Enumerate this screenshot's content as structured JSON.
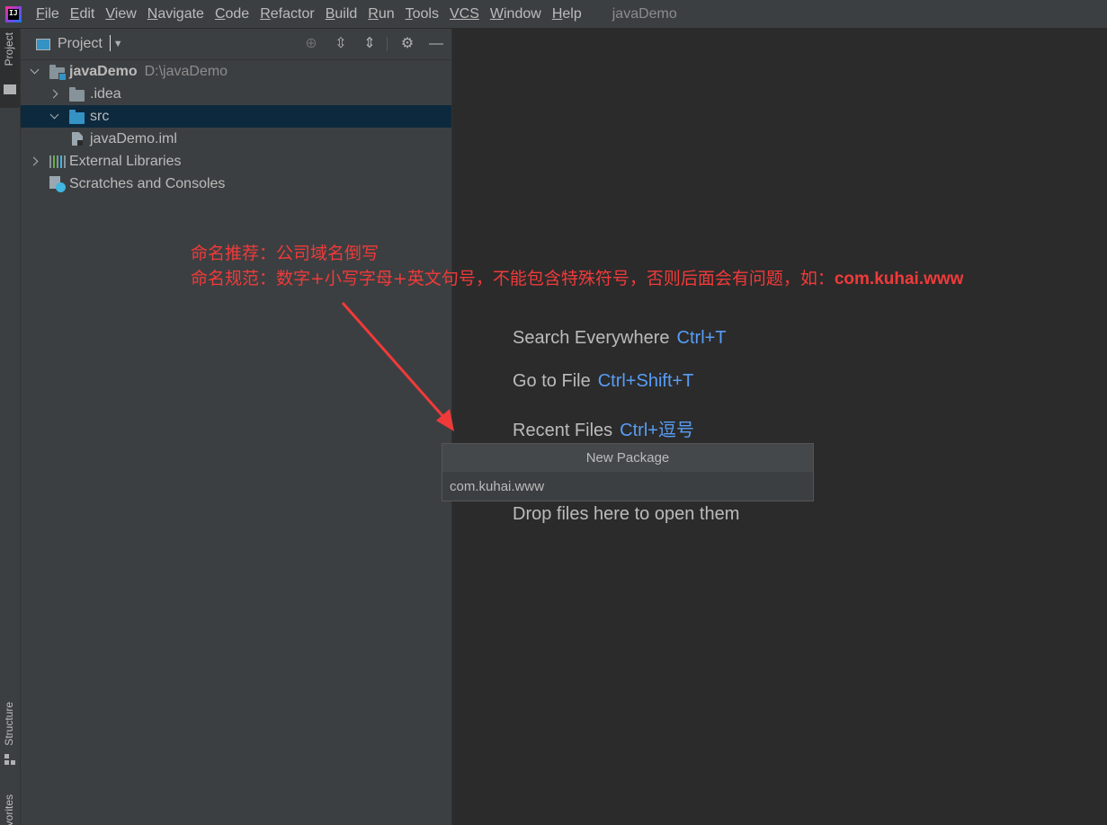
{
  "menubar": {
    "items": [
      {
        "mnemonic": "F",
        "rest": "ile"
      },
      {
        "mnemonic": "E",
        "rest": "dit"
      },
      {
        "mnemonic": "V",
        "rest": "iew"
      },
      {
        "mnemonic": "N",
        "rest": "avigate"
      },
      {
        "mnemonic": "C",
        "rest": "ode"
      },
      {
        "mnemonic": "R",
        "rest": "efactor"
      },
      {
        "mnemonic": "B",
        "rest": "uild"
      },
      {
        "mnemonic": "R",
        "rest": "un"
      },
      {
        "mnemonic": "T",
        "rest": "ools"
      },
      {
        "mnemonic": "",
        "rest": "VCS"
      },
      {
        "mnemonic": "W",
        "rest": "indow"
      },
      {
        "mnemonic": "H",
        "rest": "elp"
      }
    ],
    "window_title": "javaDemo"
  },
  "left_strip": {
    "project_tab": "Project",
    "structure_tab": "Structure",
    "favorites_tab": "Favorites"
  },
  "project_panel": {
    "title": "Project",
    "tree": {
      "root": {
        "label": "javaDemo",
        "path": "D:\\javaDemo"
      },
      "idea": ".idea",
      "src": "src",
      "iml": "javaDemo.iml",
      "external": "External Libraries",
      "scratches": "Scratches and Consoles"
    }
  },
  "annotation": {
    "line1": "命名推荐：公司域名倒写",
    "line2_prefix": "命名规范：数字+小写字母+英文句号，不能包含特殊符号，否则后面会有问题，如：",
    "line2_example": "com.kuhai.www",
    "color": "#f03a3a"
  },
  "welcome": {
    "search": {
      "label": "Search Everywhere",
      "key": "Ctrl+T"
    },
    "goto": {
      "label": "Go to File",
      "key": "Ctrl+Shift+T"
    },
    "recent": {
      "label": "Recent Files",
      "key": "Ctrl+逗号"
    },
    "drop": "Drop files here to open them"
  },
  "new_package": {
    "title": "New Package",
    "value": "com.kuhai.www"
  },
  "colors": {
    "accent": "#589df6",
    "selection": "#0d293e",
    "panel": "#3c3f41",
    "editor": "#2b2b2b"
  }
}
